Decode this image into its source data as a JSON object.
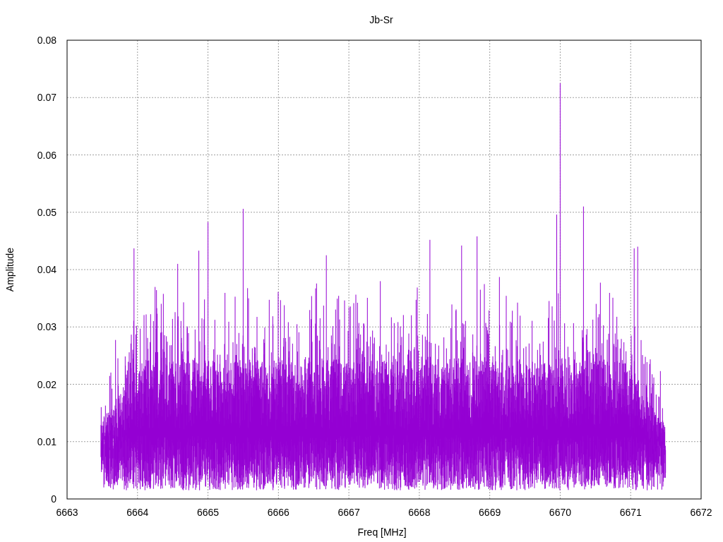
{
  "chart": {
    "title": "Jb-Sr",
    "xlabel": "Freq [MHz]",
    "ylabel": "Amplitude",
    "xticks": [
      "6663",
      "6664",
      "6665",
      "6666",
      "6667",
      "6668",
      "6669",
      "6670",
      "6671",
      "6672"
    ],
    "yticks": [
      "0.08",
      "0.07",
      "0.06",
      "0.05",
      "0.04",
      "0.03",
      "0.02",
      "0.01",
      "0"
    ]
  }
}
